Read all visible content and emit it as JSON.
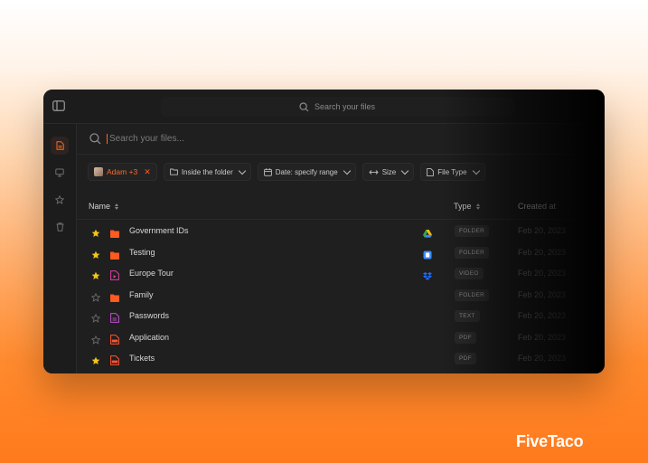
{
  "top_search": {
    "placeholder": "Search your files"
  },
  "main_search": {
    "placeholder": "Search your files..."
  },
  "filters": {
    "user_chip": "Adam +3",
    "folder_chip": "Inside the folder",
    "date_chip": "Date: specify range",
    "size_chip": "Size",
    "type_chip": "File Type"
  },
  "table": {
    "headers": {
      "name": "Name",
      "type": "Type",
      "created": "Created at"
    },
    "rows": [
      {
        "name": "Government IDs",
        "type": "FOLDER",
        "starred": true,
        "icon": "folder-icon",
        "source": "google-drive-icon",
        "date": "Feb 20, 2023"
      },
      {
        "name": "Testing",
        "type": "FOLDER",
        "starred": true,
        "icon": "folder-icon",
        "source": "blue-cloud-icon",
        "date": "Feb 20, 2023"
      },
      {
        "name": "Europe Tour",
        "type": "VIDEO",
        "starred": true,
        "icon": "video-file-icon",
        "source": "dropbox-icon",
        "date": "Feb 20, 2023"
      },
      {
        "name": "Family",
        "type": "FOLDER",
        "starred": false,
        "icon": "folder-icon",
        "source": "",
        "date": "Feb 20, 2023"
      },
      {
        "name": "Passwords",
        "type": "TEXT",
        "starred": false,
        "icon": "text-file-icon",
        "source": "",
        "date": "Feb 20, 2023"
      },
      {
        "name": "Application",
        "type": "PDF",
        "starred": false,
        "icon": "pdf-file-icon",
        "source": "",
        "date": "Feb 20, 2023"
      },
      {
        "name": "Tickets",
        "type": "PDF",
        "starred": true,
        "icon": "pdf-file-icon",
        "source": "",
        "date": "Feb 20, 2023"
      }
    ]
  },
  "brand": {
    "name": "FiveTaco"
  },
  "colors": {
    "accent": "#ff6a1a",
    "star": "#f5c518",
    "folder": "#ff5a1f",
    "video": "#e040a0",
    "text_file": "#c050d0",
    "pdf": "#ff5533"
  }
}
